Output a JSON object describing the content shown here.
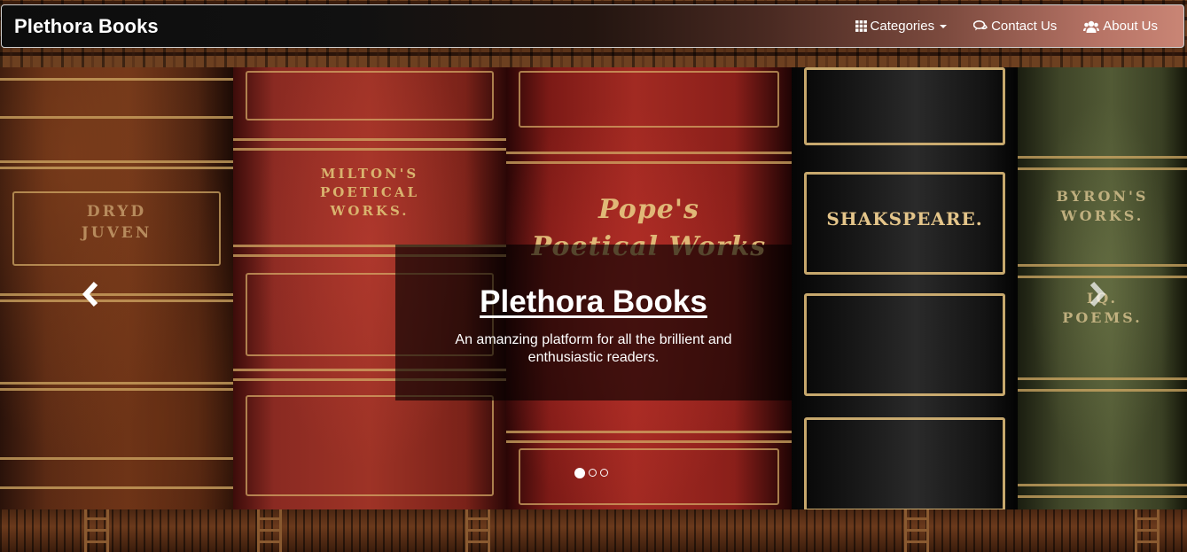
{
  "navbar": {
    "brand": "Plethora Books",
    "items": [
      {
        "label": "Categories",
        "icon": "grid-icon",
        "dropdown": true
      },
      {
        "label": "Contact Us",
        "icon": "chat-icon"
      },
      {
        "label": "About Us",
        "icon": "users-icon"
      }
    ]
  },
  "carousel": {
    "caption_title": "Plethora Books",
    "caption_text": "An amanzing platform for all the brillient and enthusiastic readers.",
    "slide_count": 3,
    "active_slide": 1,
    "prev_icon": "chevron-left-icon",
    "next_icon": "chevron-right-icon",
    "spine_labels": {
      "spine1": "DRYD\nJUVEN",
      "spine2": "MILTON'S\nPOETICAL\nWORKS.",
      "spine3": "Pope's\nPoetical Works",
      "spine4": "SHAKSPEARE.",
      "spine5": "BYRON'S\nWORKS.",
      "spine5b": "IQ.\nPOEMS."
    }
  },
  "colors": {
    "navbar_start": "#0d0d0d",
    "navbar_end": "#c98575",
    "caption_overlay": "rgba(0,0,0,0.62)",
    "text": "#ffffff",
    "gold": "#d9b36e"
  }
}
